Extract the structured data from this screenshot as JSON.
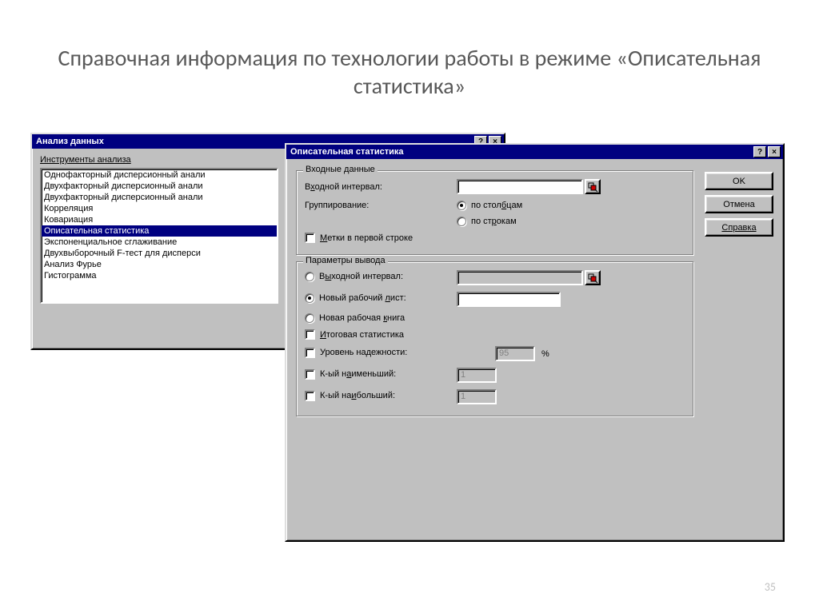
{
  "slide": {
    "title": "Справочная информация по технологии работы в режиме «Описательная статистика»",
    "page_number": "35"
  },
  "analysis_window": {
    "title": "Анализ данных",
    "tools_label": "Инструменты анализа",
    "items": [
      "Однофакторный дисперсионный анали",
      "Двухфакторный дисперсионный анали",
      "Двухфакторный дисперсионный анали",
      "Корреляция",
      "Ковариация",
      "Описательная статистика",
      "Экспоненциальное сглаживание",
      "Двухвыборочный F-тест для дисперси",
      "Анализ Фурье",
      "Гистограмма"
    ],
    "selected_index": 5
  },
  "desc_window": {
    "title": "Описательная статистика",
    "buttons": {
      "ok": "OK",
      "cancel": "Отмена",
      "help": "Справка"
    },
    "input_group": {
      "legend": "Входные данные",
      "input_range_label_pre": "В",
      "input_range_label_hot": "х",
      "input_range_label_post": "одной интервал:",
      "input_range_value": "",
      "grouping_label": "Группирование:",
      "grouping_cols_pre": "по стол",
      "grouping_cols_hot": "б",
      "grouping_cols_post": "цам",
      "grouping_rows_pre": "по ст",
      "grouping_rows_hot": "р",
      "grouping_rows_post": "окам",
      "labels_first_row_hot": "М",
      "labels_first_row_post": "етки в первой строке"
    },
    "output_group": {
      "legend": "Параметры вывода",
      "output_range_label_pre": "В",
      "output_range_label_hot": "ы",
      "output_range_label_post": "ходной интервал:",
      "new_sheet_label_pre": "Новый рабочий ",
      "new_sheet_label_hot": "л",
      "new_sheet_label_post": "ист:",
      "new_book_label_pre": "Новая рабочая ",
      "new_book_label_hot": "к",
      "new_book_label_post": "нига",
      "summary_label_hot": "И",
      "summary_label_post": "тоговая статистика",
      "confidence_label": "Уровень надежности:",
      "confidence_value": "95",
      "confidence_pct": "%",
      "kth_smallest_pre": "К-ый н",
      "kth_smallest_hot": "а",
      "kth_smallest_post": "именьший:",
      "kth_smallest_value": "1",
      "kth_largest_pre": "К-ый на",
      "kth_largest_hot": "и",
      "kth_largest_post": "больший:",
      "kth_largest_value": "1"
    }
  }
}
